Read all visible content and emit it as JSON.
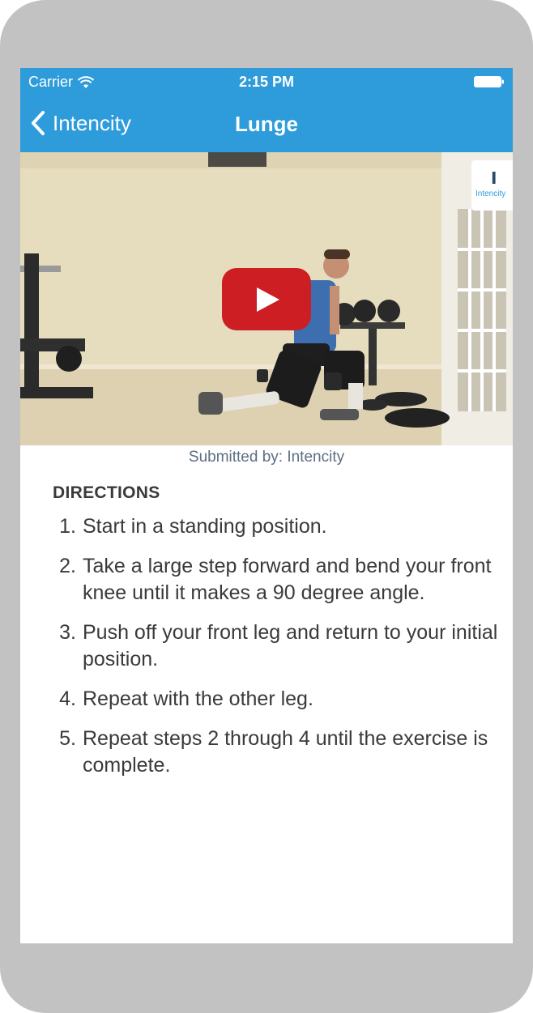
{
  "status_bar": {
    "carrier": "Carrier",
    "time": "2:15 PM"
  },
  "nav": {
    "back_label": "Intencity",
    "title": "Lunge"
  },
  "video": {
    "watermark_text": "Intencity",
    "play_color": "#cc1e23"
  },
  "submitted_by": "Submitted by: Intencity",
  "directions": {
    "title": "DIRECTIONS",
    "steps": [
      {
        "num": "1.",
        "text": "Start in a standing position."
      },
      {
        "num": "2.",
        "text": "Take a large step forward and bend your front knee until it makes a 90 degree angle."
      },
      {
        "num": "3.",
        "text": "Push off your front leg and return to your initial position."
      },
      {
        "num": "4.",
        "text": "Repeat with the other leg."
      },
      {
        "num": "5.",
        "text": "Repeat steps 2 through 4 until the exercise is complete."
      }
    ]
  },
  "colors": {
    "accent": "#2e9bdb",
    "device_frame": "#c2c2c2",
    "text": "#3a3a3a"
  }
}
